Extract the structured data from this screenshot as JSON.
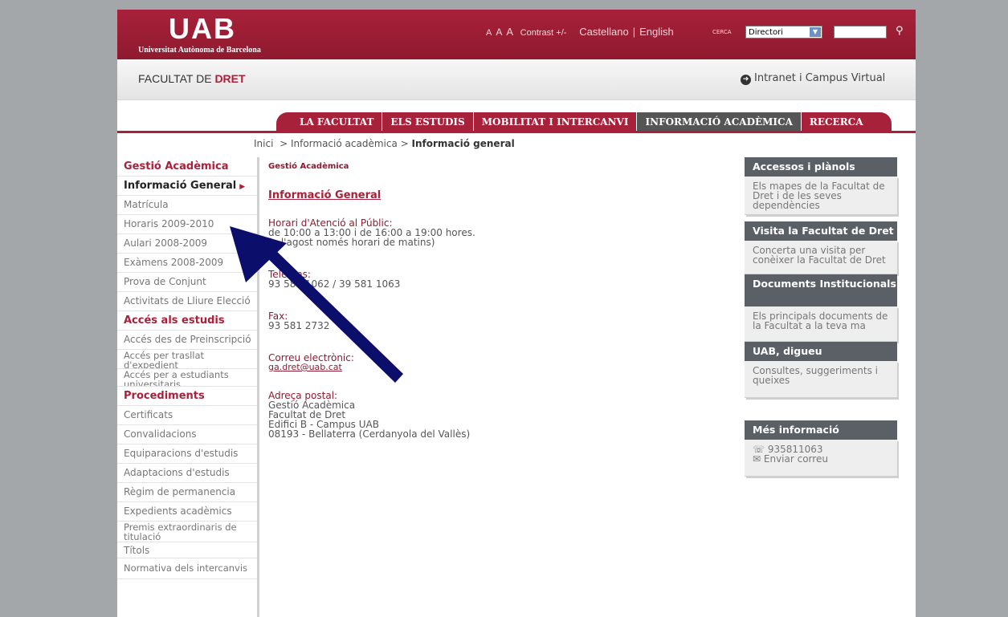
{
  "header": {
    "logo_text": "UAB",
    "logo_subtitle": "Universitat Autònoma de Barcelona",
    "font_size_labels": [
      "A",
      "A",
      "A"
    ],
    "contrast_label": "Contrast +/-",
    "lang_castellano": "Castellano",
    "lang_separator": "|",
    "lang_english": "English",
    "search_label": "CERCA",
    "search_select_value": "Directori",
    "search_input_value": ""
  },
  "faculty_bar": {
    "title_prefix": "FACULTAT DE",
    "title_highlight": "DRET",
    "intranet_label": "Intranet i Campus Virtual"
  },
  "nav": {
    "items": [
      {
        "label": "LA FACULTAT"
      },
      {
        "label": "ELS ESTUDIS"
      },
      {
        "label": "MOBILITAT I INTERCANVI"
      },
      {
        "label": "INFORMACIÓ ACADÈMICA"
      },
      {
        "label": "RECERCA"
      }
    ],
    "active_index": 3
  },
  "breadcrumb": {
    "home": "Inici",
    "sep1": ">",
    "level1": "Informació acadèmica",
    "sep2": ">",
    "current": "Informació general"
  },
  "sidebar": {
    "items": [
      {
        "label": "Gestió Acadèmica"
      },
      {
        "label": "Informació General"
      },
      {
        "label": "Matrícula"
      },
      {
        "label": "Horaris 2009-2010"
      },
      {
        "label": "Aulari 2008-2009"
      },
      {
        "label": "Exàmens 2008-2009"
      },
      {
        "label": "Prova de Conjunt"
      },
      {
        "label": "Activitats de Lliure Elecció"
      },
      {
        "label": "Accés als estudis"
      },
      {
        "label": "Accés des de Preinscripció"
      },
      {
        "label": "Accés per trasllat d'expedient"
      },
      {
        "label": "Accés per a estudiants universitaris"
      },
      {
        "label": "Procediments"
      },
      {
        "label": "Certificats"
      },
      {
        "label": "Convalidacions"
      },
      {
        "label": "Equiparacions d'estudis"
      },
      {
        "label": "Adaptacions d'estudis"
      },
      {
        "label": "Règim de permanencia"
      },
      {
        "label": "Expedients acadèmics"
      },
      {
        "label": "Premis extraordinaris de titulació"
      },
      {
        "label": "Títols"
      },
      {
        "label": "Normativa dels intercanvis"
      }
    ]
  },
  "main": {
    "section": "Gestió Acadèmica",
    "title": "Informació General",
    "hours_label": "Horari d'Atenció al Públic:",
    "hours_line1": "de 10:00 a 13:00 i de 16:00 a 19:00 hores.",
    "hours_line2": "(a l'agost només horari de matins)",
    "phones_label": "Telèfons:",
    "phones_value": "93 581 1062 / 39 581 1063",
    "fax_label": "Fax:",
    "fax_value": "93 581 2732",
    "email_label": "Correu electrònic:",
    "email_value": "ga.dret@uab.cat",
    "address_label": "Adreça postal:",
    "address_line1": "Gestió Acadèmica",
    "address_line2": "Facultat de Dret",
    "address_line3": "Edifici B - Campus UAB",
    "address_line4": "08193 - Bellaterra (Cerdanyola del Vallès)"
  },
  "right": {
    "boxes": [
      {
        "title": "Accessos i plànols",
        "body": "Els mapes de la Facultat de Dret i de les seves dependències"
      },
      {
        "title": "Visita la Facultat de Dret",
        "body": "Concerta una visita per conèixer la Facultat de Dret"
      },
      {
        "title": "Documents Institucionals",
        "body": "Els principals documents de la Facultat a la teva ma"
      },
      {
        "title": "UAB, digueu",
        "body": "Consultes, suggeriments i queixes"
      }
    ],
    "more": {
      "title": "Més informació",
      "phone": "935811063",
      "email_link": "Enviar correu"
    }
  },
  "colors": {
    "brand": "#a8213a",
    "nav_active": "#555555",
    "arrow": "#0b0f6b",
    "background": "#a4a7aa"
  },
  "icons": {
    "search": "search-icon",
    "intranet": "arrow-circle-icon",
    "select": "chevron-down-icon",
    "phone": "phone-icon",
    "mail": "envelope-icon"
  }
}
